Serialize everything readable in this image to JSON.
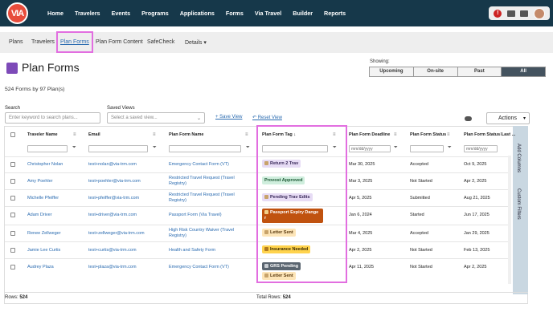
{
  "nav": {
    "logo": "VIA",
    "links": [
      "Home",
      "Travelers",
      "Events",
      "Programs",
      "Applications",
      "Forms",
      "Via Travel",
      "Builder",
      "Reports"
    ],
    "alert_count": "!"
  },
  "subnav": {
    "items": [
      "Plans",
      "Travelers",
      "Plan Forms",
      "Plan Form Content",
      "SafeCheck",
      "Details ▾"
    ]
  },
  "page": {
    "title": "Plan Forms",
    "count": "524 Forms by 97 Plan(s)"
  },
  "showing": {
    "label": "Showing:",
    "options": [
      "Upcoming",
      "On-site",
      "Past",
      "All"
    ],
    "selected": "All"
  },
  "search": {
    "label": "Search",
    "placeholder": "Enter keyword to search plans..."
  },
  "saved_views": {
    "label": "Saved Views",
    "placeholder": "Select a saved view...",
    "save": "+ Save View",
    "reset": "↶ Reset View"
  },
  "actions_label": "Actions",
  "table": {
    "columns": [
      "Traveler Name",
      "Email",
      "Plan Form Name",
      "Plan Form Tag ↓",
      "Plan Form Deadline",
      "Plan Form Status",
      "Plan Form Status Last ..."
    ],
    "date_placeholder": "mm/dd/yyyy",
    "rows": [
      {
        "name": "Christopher Nolan",
        "email": "test+nolan@via-trm.com",
        "form": "Emergency Contact Form (VT)",
        "tag": "Return 2 Trav",
        "deadline": "Mar 30, 2025",
        "status": "Accepted",
        "last": "Oct 9, 2025"
      },
      {
        "name": "Amy Poehler",
        "email": "test+poehler@via-trm.com",
        "form": "Restricted Travel Request (Travel Registry)",
        "tag": "Provost Approved",
        "deadline": "Mar 3, 2025",
        "status": "Not Started",
        "last": "Apr 2, 2025"
      },
      {
        "name": "Michelle Pfeiffer",
        "email": "test+pfeiffer@via-trm.com",
        "form": "Restricted Travel Request (Travel Registry)",
        "tag": "Pending Trav Edits",
        "deadline": "Apr 5, 2025",
        "status": "Submitted",
        "last": "Aug 21, 2025"
      },
      {
        "name": "Adam Driver",
        "email": "test+driver@via-trm.com",
        "form": "Passport Form (Via Travel)",
        "tag": "Passport Expiry Dange r",
        "deadline": "Jan 6, 2024",
        "status": "Started",
        "last": "Jun 17, 2025"
      },
      {
        "name": "Renee Zellweger",
        "email": "test+zellweger@via-trm.com",
        "form": "High Risk Country Waiver (Travel Registry)",
        "tag": "Letter Sent",
        "deadline": "Mar 4, 2025",
        "status": "Accepted",
        "last": "Jan 29, 2025"
      },
      {
        "name": "Jamie Lee Curtis",
        "email": "test+curtis@via-trm.com",
        "form": "Health and Safety Form",
        "tag": "Insurance Needed",
        "deadline": "Apr 2, 2025",
        "status": "Not Started",
        "last": "Feb 13, 2025"
      },
      {
        "name": "Audrey Plaza",
        "email": "test+plaza@via-trm.com",
        "form": "Emergency Contact Form (VT)",
        "tag": "GRS Pending",
        "tag2": "Letter Sent",
        "deadline": "Apr 11, 2025",
        "status": "Not Started",
        "last": "Apr 2, 2025"
      }
    ]
  },
  "side_panel": {
    "add_columns": "Add Columns",
    "custom_filters": "Custom Filters"
  },
  "footer": {
    "rows_label": "Rows:",
    "rows_value": "524",
    "total_label": "Total Rows:",
    "total_value": "524"
  },
  "colors": {
    "nav_bg": "#16384a",
    "highlight": "#e26ee0",
    "link": "#2a6bb0"
  }
}
